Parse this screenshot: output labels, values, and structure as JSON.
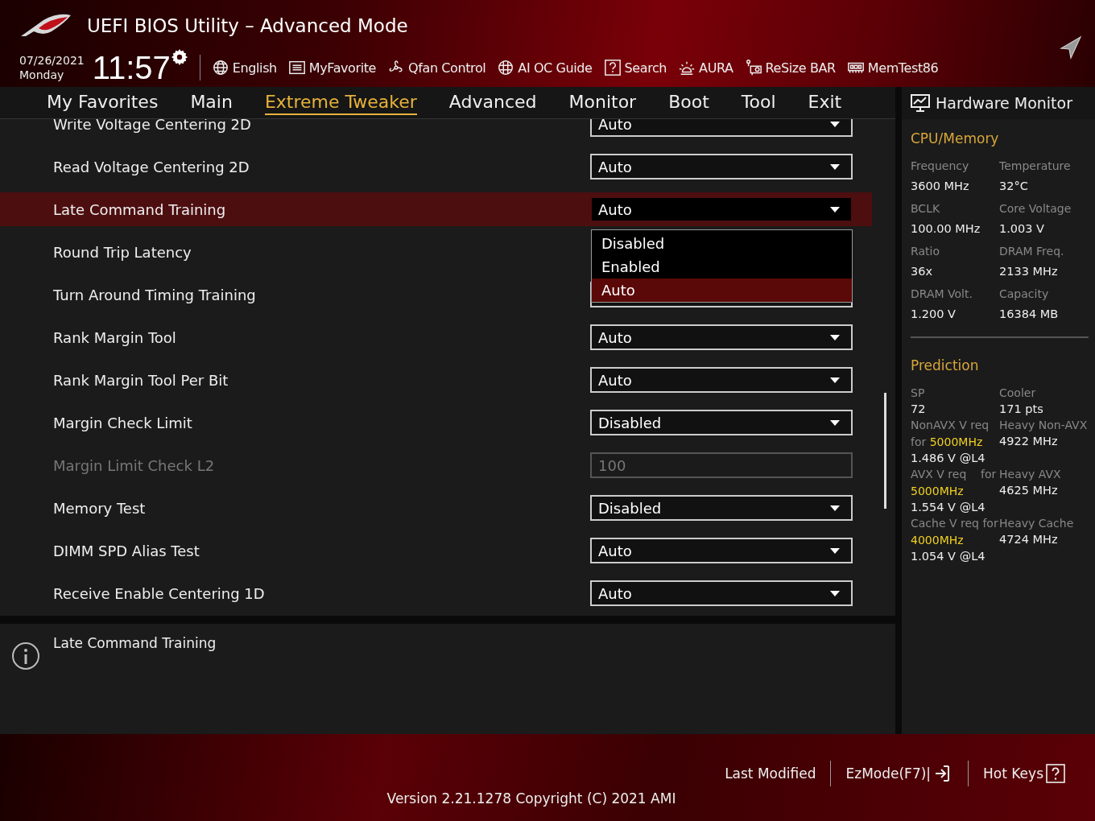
{
  "window": {
    "title": "UEFI BIOS Utility – Advanced Mode"
  },
  "clock": {
    "date": "07/26/2021",
    "weekday": "Monday",
    "time": "11:57"
  },
  "toolbar": [
    {
      "label": "English",
      "kind": "globe"
    },
    {
      "label": "MyFavorite",
      "kind": "list"
    },
    {
      "label": "Qfan Control",
      "kind": "fan"
    },
    {
      "label": "AI OC Guide",
      "kind": "chip"
    },
    {
      "label": "Search",
      "kind": "help"
    },
    {
      "label": "AURA",
      "kind": "light"
    },
    {
      "label": "ReSize BAR",
      "kind": "card"
    },
    {
      "label": "MemTest86",
      "kind": "memory"
    }
  ],
  "tabs": [
    {
      "label": "My Favorites",
      "selected": false
    },
    {
      "label": "Main",
      "selected": false
    },
    {
      "label": "Extreme Tweaker",
      "selected": true
    },
    {
      "label": "Advanced",
      "selected": false
    },
    {
      "label": "Monitor",
      "selected": false
    },
    {
      "label": "Boot",
      "selected": false
    },
    {
      "label": "Tool",
      "selected": false
    },
    {
      "label": "Exit",
      "selected": false
    }
  ],
  "settings": [
    {
      "label": "Write Voltage Centering 2D",
      "kind": "dropdown",
      "value": "Auto",
      "selected": false,
      "disabled": false
    },
    {
      "label": "Read Voltage Centering 2D",
      "kind": "dropdown",
      "value": "Auto",
      "selected": false,
      "disabled": false
    },
    {
      "label": "Late Command Training",
      "kind": "dropdown",
      "value": "Auto",
      "selected": true,
      "disabled": false,
      "options": [
        {
          "label": "Disabled",
          "selected": false
        },
        {
          "label": "Enabled",
          "selected": false
        },
        {
          "label": "Auto",
          "selected": true
        }
      ]
    },
    {
      "label": "Round Trip Latency",
      "kind": "hidden",
      "selected": false,
      "disabled": false
    },
    {
      "label": "Turn Around Timing Training",
      "kind": "dropdown",
      "selected": false,
      "disabled": false
    },
    {
      "label": "Rank Margin Tool",
      "kind": "dropdown",
      "value": "Auto",
      "selected": false,
      "disabled": false
    },
    {
      "label": "Rank Margin Tool Per Bit",
      "kind": "dropdown",
      "value": "Auto",
      "selected": false,
      "disabled": false
    },
    {
      "label": "Margin Check Limit",
      "kind": "dropdown",
      "value": "Disabled",
      "selected": false,
      "disabled": false
    },
    {
      "label": "Margin Limit Check L2",
      "kind": "number",
      "value": "100",
      "selected": false,
      "disabled": true
    },
    {
      "label": "Memory Test",
      "kind": "dropdown",
      "value": "Disabled",
      "selected": false,
      "disabled": false
    },
    {
      "label": "DIMM SPD Alias Test",
      "kind": "dropdown",
      "value": "Auto",
      "selected": false,
      "disabled": false
    },
    {
      "label": "Receive Enable Centering 1D",
      "kind": "dropdown",
      "value": "Auto",
      "selected": false,
      "disabled": false
    }
  ],
  "help": {
    "text": "Late Command Training"
  },
  "hardware_monitor": {
    "title": "Hardware Monitor",
    "sections": [
      {
        "title": "CPU/Memory",
        "items": [
          {
            "label": "Frequency",
            "value": "3600 MHz"
          },
          {
            "label": "Temperature",
            "value": "32°C"
          },
          {
            "label": "BCLK",
            "value": "100.00 MHz"
          },
          {
            "label": "Core Voltage",
            "value": "1.003 V"
          },
          {
            "label": "Ratio",
            "value": "36x"
          },
          {
            "label": "DRAM Freq.",
            "value": "2133 MHz"
          },
          {
            "label": "DRAM Volt.",
            "value": "1.200 V"
          },
          {
            "label": "Capacity",
            "value": "16384 MB"
          }
        ]
      },
      {
        "title": "Prediction",
        "items": [
          {
            "label": "SP",
            "value": "72"
          },
          {
            "label": "Cooler",
            "value": "171 pts"
          },
          {
            "label": "NonAVX V req for **5000MHz**",
            "value": "1.486 V @L4"
          },
          {
            "label": "Heavy Non-AVX",
            "value": "4922 MHz"
          },
          {
            "label": "AVX V req    for **5000MHz**",
            "value": "1.554 V @L4"
          },
          {
            "label": "Heavy AVX",
            "value": "4625 MHz"
          },
          {
            "label": "Cache V req for **4000MHz**",
            "value": "1.054 V @L4"
          },
          {
            "label": "Heavy Cache",
            "value": "4724 MHz"
          }
        ]
      }
    ]
  },
  "footer": {
    "buttons": [
      {
        "label": "Last Modified",
        "kind": "plain"
      },
      {
        "label": "EzMode(F7)|",
        "kind": "exit"
      },
      {
        "label": "Hot Keys",
        "kind": "help"
      }
    ],
    "version": "Version 2.21.1278 Copyright (C) 2021 AMI"
  }
}
